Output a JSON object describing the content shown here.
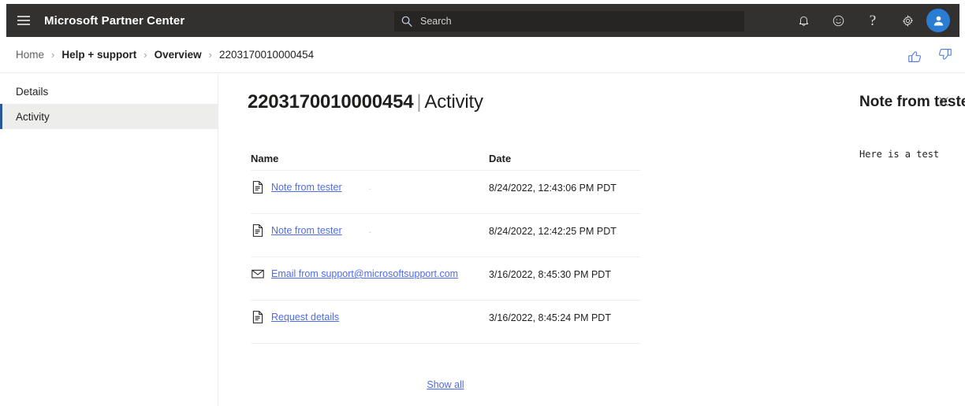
{
  "header": {
    "brand": "Microsoft Partner Center",
    "menu_icon": "hamburger-icon",
    "search": {
      "placeholder": "Search",
      "value": "",
      "icon": "search-icon"
    },
    "actions": [
      {
        "name": "notifications-icon",
        "label": "Notifications"
      },
      {
        "name": "feedback-smiley-icon",
        "label": "Feedback"
      },
      {
        "name": "help-icon",
        "label": "?"
      },
      {
        "name": "settings-gear-icon",
        "label": "Settings"
      },
      {
        "name": "account-avatar",
        "label": "Account"
      }
    ],
    "colors": {
      "bar": "#323130",
      "search_bg": "#272523",
      "avatar": "#2b7cd3"
    }
  },
  "breadcrumb": {
    "separator": "›",
    "items": [
      {
        "label": "Home",
        "current": false,
        "bold": false
      },
      {
        "label": "Help + support",
        "current": false,
        "bold": true
      },
      {
        "label": "Overview",
        "current": false,
        "bold": true
      },
      {
        "label": "2203170010000454",
        "current": true,
        "bold": false
      }
    ],
    "feedback": [
      {
        "name": "thumbs-up-icon",
        "label": "Like"
      },
      {
        "name": "thumbs-down-icon",
        "label": "Dislike"
      }
    ]
  },
  "sidebar": {
    "items": [
      {
        "label": "Details",
        "selected": false
      },
      {
        "label": "Activity",
        "selected": true
      }
    ],
    "accent_color": "#2b579a",
    "selected_bg": "#ededeb"
  },
  "main": {
    "title_id": "2203170010000454",
    "title_separator": "|",
    "title_section": "Activity",
    "table": {
      "columns": [
        "Name",
        "Date"
      ],
      "rows": [
        {
          "icon": "document-icon",
          "name": "Note from tester",
          "marker": ".",
          "date": "8/24/2022, 12:43:06 PM PDT"
        },
        {
          "icon": "document-icon",
          "name": "Note from tester",
          "marker": ".",
          "date": "8/24/2022, 12:42:25 PM PDT"
        },
        {
          "icon": "envelope-icon",
          "name": "Email from support@microsoftsupport.com",
          "marker": "",
          "date": "3/16/2022, 8:45:30 PM PDT"
        },
        {
          "icon": "document-icon",
          "name": "Request details",
          "marker": "",
          "date": "3/16/2022, 8:45:24 PM PDT"
        }
      ]
    },
    "show_all_label": "Show all",
    "link_color": "#4f6bed"
  },
  "detail_pane": {
    "title": "Note from tester",
    "body": "Here is a test",
    "close_icon": "close-icon"
  }
}
